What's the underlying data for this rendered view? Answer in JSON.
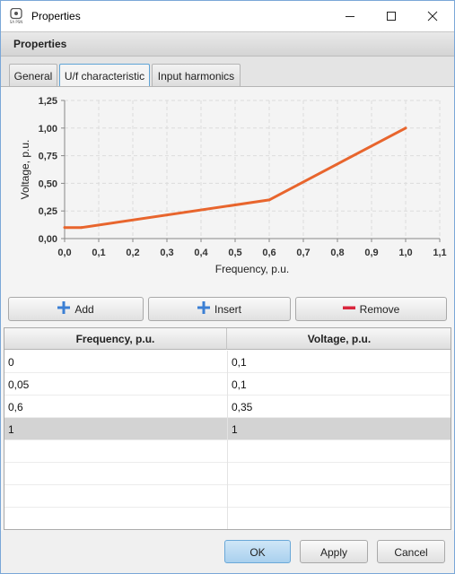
{
  "window": {
    "title": "Properties",
    "app_icon_text": "SA PSN"
  },
  "header": {
    "title": "Properties"
  },
  "tabs": [
    {
      "label": "General"
    },
    {
      "label": "U/f characteristic",
      "active": true
    },
    {
      "label": "Input harmonics"
    }
  ],
  "chart_data": {
    "type": "line",
    "xlabel": "Frequency, p.u.",
    "ylabel": "Voltage, p.u.",
    "xlim": [
      0,
      1.1
    ],
    "ylim": [
      0,
      1.25
    ],
    "x_ticks": [
      "0,0",
      "0,1",
      "0,2",
      "0,3",
      "0,4",
      "0,5",
      "0,6",
      "0,7",
      "0,8",
      "0,9",
      "1,0",
      "1,1"
    ],
    "y_ticks": [
      "0,00",
      "0,25",
      "0,50",
      "0,75",
      "1,00",
      "1,25"
    ],
    "grid": true,
    "series": [
      {
        "x": [
          0,
          0.05,
          0.6,
          1.0
        ],
        "y": [
          0.1,
          0.1,
          0.35,
          1.0
        ],
        "color": "#e8652d"
      }
    ]
  },
  "toolbar": {
    "add_label": "Add",
    "insert_label": "Insert",
    "remove_label": "Remove"
  },
  "table": {
    "columns": [
      "Frequency, p.u.",
      "Voltage, p.u."
    ],
    "rows": [
      [
        "0",
        "0,1"
      ],
      [
        "0,05",
        "0,1"
      ],
      [
        "0,6",
        "0,35"
      ],
      [
        "1",
        "1"
      ]
    ],
    "selected_row": 3
  },
  "footer": {
    "ok_label": "OK",
    "apply_label": "Apply",
    "cancel_label": "Cancel"
  },
  "colors": {
    "accent": "#5fa4d6",
    "series_line": "#e8652d",
    "add_icon": "#3b7fd4",
    "remove_icon": "#d9263d"
  }
}
